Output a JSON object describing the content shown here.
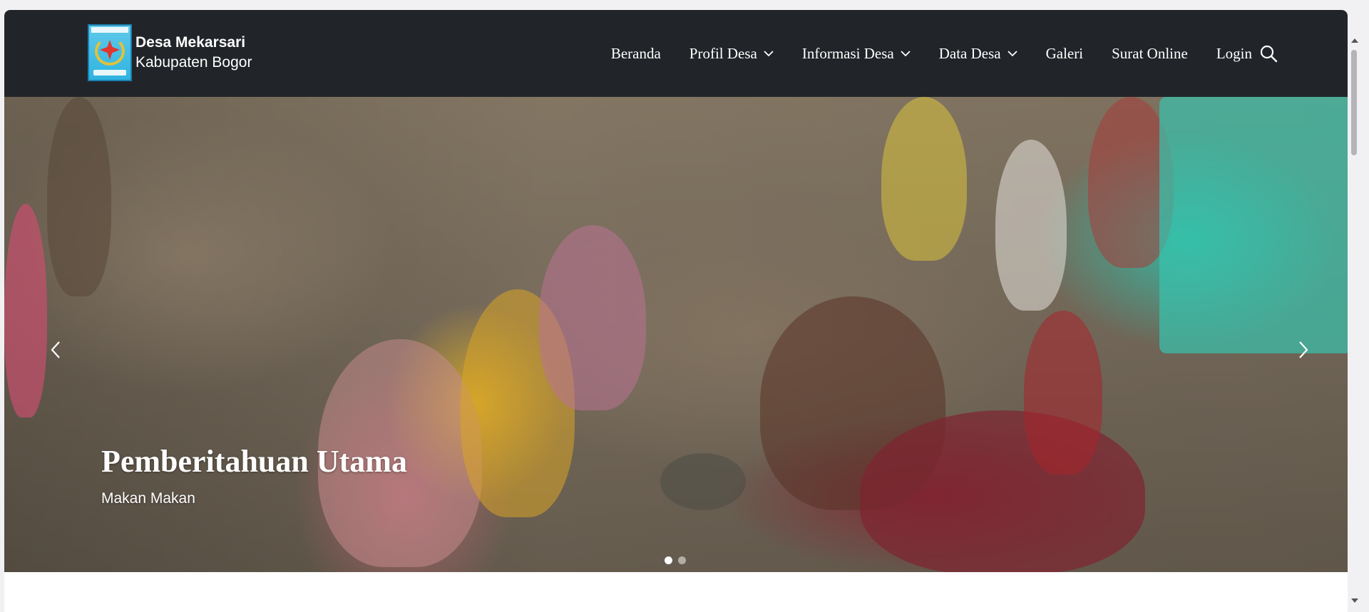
{
  "brand": {
    "name": "Desa Mekarsari",
    "subtitle": "Kabupaten Bogor",
    "logo_icon": "village-emblem-logo"
  },
  "nav": {
    "items": [
      {
        "label": "Beranda",
        "dropdown": false
      },
      {
        "label": "Profil Desa",
        "dropdown": true
      },
      {
        "label": "Informasi Desa",
        "dropdown": true
      },
      {
        "label": "Data Desa",
        "dropdown": true
      },
      {
        "label": "Galeri",
        "dropdown": false
      },
      {
        "label": "Surat Online",
        "dropdown": false
      },
      {
        "label": "Login",
        "dropdown": false
      }
    ],
    "search_icon": "search-icon"
  },
  "hero": {
    "title": "Pemberitahuan Utama",
    "text": "Makan Makan",
    "slides_count": 2,
    "active_slide": 1,
    "prev_icon": "chevron-left-icon",
    "next_icon": "chevron-right-icon"
  },
  "colors": {
    "navbar_bg": "#212529",
    "nav_text": "#ffffff",
    "page_bg": "#ffffff"
  }
}
